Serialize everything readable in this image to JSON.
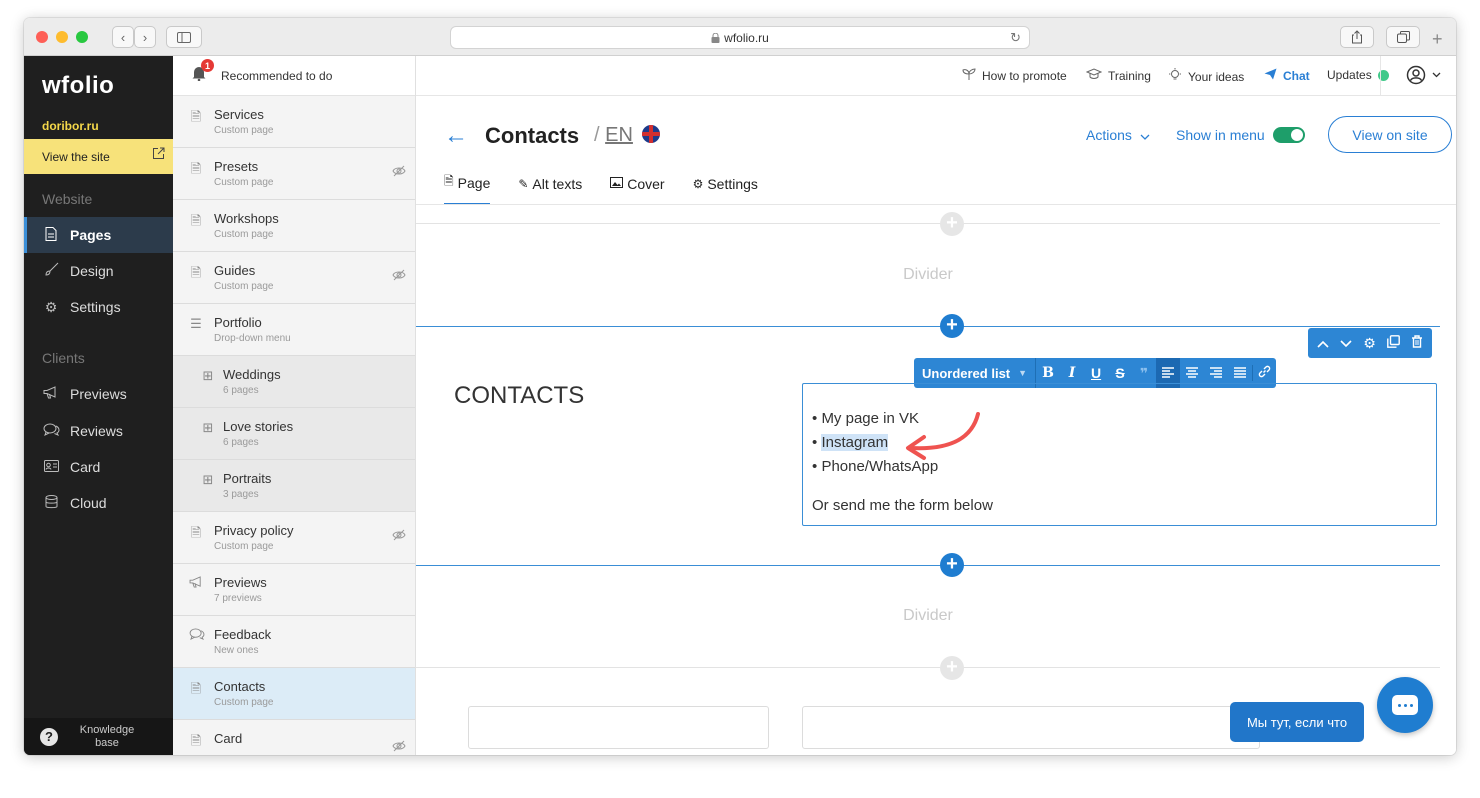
{
  "browser": {
    "url": "wfolio.ru",
    "lock_icon": "lock-icon",
    "back_icon": "‹",
    "forward_icon": "›"
  },
  "sidebar": {
    "logo": "wfolio",
    "domain": "doribor.ru",
    "view_site": "View the site",
    "website_label": "Website",
    "clients_label": "Clients",
    "website_items": [
      {
        "label": "Pages",
        "icon": "page-icon"
      },
      {
        "label": "Design",
        "icon": "brush-icon"
      },
      {
        "label": "Settings",
        "icon": "gear-icon"
      }
    ],
    "clients_items": [
      {
        "label": "Previews",
        "icon": "megaphone-icon"
      },
      {
        "label": "Reviews",
        "icon": "chat-bubbles-icon"
      },
      {
        "label": "Card",
        "icon": "id-card-icon"
      },
      {
        "label": "Cloud",
        "icon": "database-icon"
      }
    ],
    "knowledge_base": "Knowledge base"
  },
  "notifications": {
    "badge": "1",
    "label": "Recommended to do"
  },
  "pages_list": [
    {
      "title": "Services",
      "subtitle": "Custom page",
      "hidden": false
    },
    {
      "title": "Presets",
      "subtitle": "Custom page",
      "hidden": true
    },
    {
      "title": "Workshops",
      "subtitle": "Custom page",
      "hidden": false
    },
    {
      "title": "Guides",
      "subtitle": "Custom page",
      "hidden": true
    },
    {
      "title": "Portfolio",
      "subtitle": "Drop-down menu",
      "hidden": false
    },
    {
      "title": "Weddings",
      "subtitle": "6 pages",
      "hidden": false
    },
    {
      "title": "Love stories",
      "subtitle": "6 pages",
      "hidden": false
    },
    {
      "title": "Portraits",
      "subtitle": "3 pages",
      "hidden": false
    },
    {
      "title": "Privacy policy",
      "subtitle": "Custom page",
      "hidden": true
    },
    {
      "title": "Previews",
      "subtitle": "7 previews",
      "hidden": false
    },
    {
      "title": "Feedback",
      "subtitle": "New ones",
      "hidden": false
    },
    {
      "title": "Contacts",
      "subtitle": "Custom page",
      "hidden": false
    },
    {
      "title": "Card",
      "subtitle": "",
      "hidden": true
    }
  ],
  "topbar": {
    "how_to_promote": "How to promote",
    "training": "Training",
    "your_ideas": "Your ideas",
    "chat": "Chat",
    "updates": "Updates"
  },
  "header": {
    "title": "Contacts",
    "lang_prefix": "/",
    "lang": "EN",
    "actions": "Actions",
    "show_in_menu": "Show in menu",
    "view_on_site": "View on site",
    "tabs": [
      {
        "label": "Page",
        "icon": "page-icon"
      },
      {
        "label": "Alt texts",
        "icon": "edit-icon"
      },
      {
        "label": "Cover",
        "icon": "image-icon"
      },
      {
        "label": "Settings",
        "icon": "gear-icon"
      }
    ]
  },
  "content": {
    "divider_label": "Divider",
    "divider_label_2": "Divider",
    "contacts_heading": "CONTACTS",
    "format_style": "Unordered list",
    "list_items": [
      "My page in VK",
      "Instagram",
      "Phone/WhatsApp"
    ],
    "bullet": "•",
    "footer_text": "Or send me the form below"
  },
  "chat_widget": {
    "label": "Мы тут, если что"
  },
  "colors": {
    "accent": "#2a7fd4",
    "sidebar_bg": "#1f1f1f",
    "view_site_bg": "#f7e27a",
    "toggle_on": "#1e9e6a",
    "annotation_arrow": "#ef5350"
  }
}
